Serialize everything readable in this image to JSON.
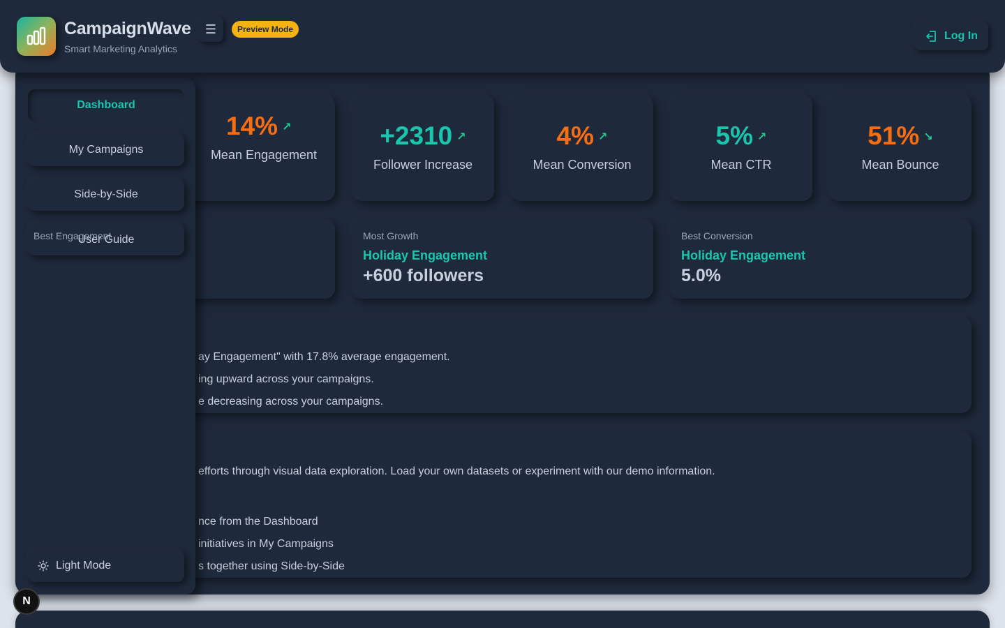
{
  "app": {
    "name": "CampaignWave",
    "tagline": "Smart Marketing Analytics",
    "preview_badge": "Preview Mode",
    "login_label": "Log In",
    "menu_icon": "hamburger-menu-icon",
    "accent_color": "#1cc5ad",
    "warning_color": "#f66d12",
    "badge_color": "#f5b311"
  },
  "sidebar": {
    "items": [
      {
        "label": "Dashboard",
        "active": true
      },
      {
        "label": "My Campaigns",
        "active": false
      },
      {
        "label": "Side-by-Side",
        "active": false
      },
      {
        "label": "User Guide",
        "active": false
      }
    ],
    "overlap_text": "Best Engagement",
    "theme_toggle_label": "Light Mode",
    "theme_icon": "sun-icon"
  },
  "stats": [
    {
      "value": "14%",
      "label": "Mean Engagement",
      "trend": "up",
      "color": "orange"
    },
    {
      "value": "+2310",
      "label": "Follower Increase",
      "trend": "up",
      "color": "teal"
    },
    {
      "value": "4%",
      "label": "Mean Conversion",
      "trend": "up",
      "color": "orange"
    },
    {
      "value": "5%",
      "label": "Mean CTR",
      "trend": "up",
      "color": "teal"
    },
    {
      "value": "51%",
      "label": "Mean Bounce",
      "trend": "down",
      "color": "orange"
    }
  ],
  "highlights": [
    {
      "heading": "Most Growth",
      "campaign": "Holiday Engagement",
      "value": "+600 followers"
    },
    {
      "heading": "Best Conversion",
      "campaign": "Holiday Engagement",
      "value": "5.0%"
    }
  ],
  "insights": {
    "lines": [
      "ay Engagement\" with 17.8% average engagement.",
      "ing upward across your campaigns.",
      "e decreasing across your campaigns."
    ]
  },
  "welcome": {
    "intro": "efforts through visual data exploration. Load your own datasets or experiment with our demo information.",
    "steps": [
      "nce from the Dashboard",
      "initiatives in My Campaigns",
      "s together using Side-by-Side"
    ]
  },
  "corner_badge": "N"
}
